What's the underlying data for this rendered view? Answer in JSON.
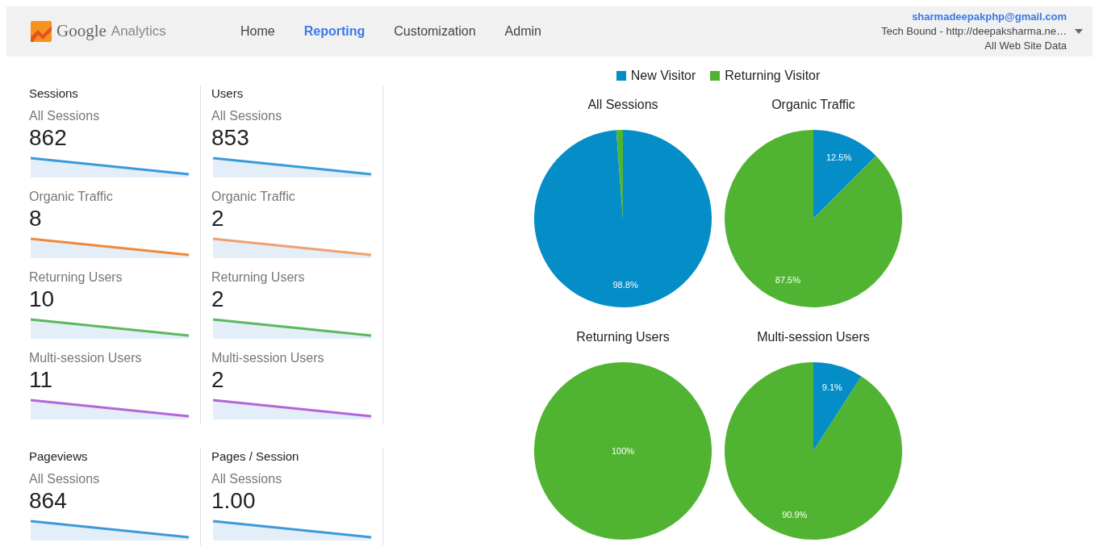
{
  "header": {
    "logo": "Google",
    "product": "Analytics",
    "nav": [
      {
        "label": "Home",
        "selected": false
      },
      {
        "label": "Reporting",
        "selected": true
      },
      {
        "label": "Customization",
        "selected": false
      },
      {
        "label": "Admin",
        "selected": false
      }
    ],
    "account": {
      "email": "sharmadeepakphp@gmail.com",
      "property": "Tech Bound - http://deepaksharma.ne…",
      "view": "All Web Site Data"
    }
  },
  "metric_groups": [
    {
      "panels": [
        {
          "title": "Sessions",
          "metrics": [
            {
              "label": "All Sessions",
              "value": "862",
              "color": "#3b9ad9"
            },
            {
              "label": "Organic Traffic",
              "value": "8",
              "color": "#f0883a"
            },
            {
              "label": "Returning Users",
              "value": "10",
              "color": "#5cb85c"
            },
            {
              "label": "Multi-session Users",
              "value": "11",
              "color": "#b565d9"
            }
          ]
        },
        {
          "title": "Users",
          "metrics": [
            {
              "label": "All Sessions",
              "value": "853",
              "color": "#3b9ad9"
            },
            {
              "label": "Organic Traffic",
              "value": "2",
              "color": "#f0a070"
            },
            {
              "label": "Returning Users",
              "value": "2",
              "color": "#5cb85c"
            },
            {
              "label": "Multi-session Users",
              "value": "2",
              "color": "#b565d9"
            }
          ]
        }
      ]
    },
    {
      "panels": [
        {
          "title": "Pageviews",
          "metrics": [
            {
              "label": "All Sessions",
              "value": "864",
              "color": "#3b9ad9"
            }
          ]
        },
        {
          "title": "Pages / Session",
          "metrics": [
            {
              "label": "All Sessions",
              "value": "1.00",
              "color": "#3b9ad9"
            }
          ]
        }
      ]
    }
  ],
  "legend": [
    {
      "label": "New Visitor",
      "color": "#058dc7"
    },
    {
      "label": "Returning Visitor",
      "color": "#50b432"
    }
  ],
  "pies": [
    {
      "chart_data": {
        "type": "pie",
        "title": "All Sessions",
        "series": [
          {
            "values": [
              98.8,
              1.2
            ]
          }
        ],
        "value_labels": [
          "98.8%",
          null
        ]
      }
    },
    {
      "chart_data": {
        "type": "pie",
        "title": "Organic Traffic",
        "series": [
          {
            "values": [
              12.5,
              87.5
            ]
          }
        ],
        "value_labels": [
          "12.5%",
          "87.5%"
        ]
      }
    },
    {
      "chart_data": {
        "type": "pie",
        "title": "Returning Users",
        "series": [
          {
            "values": [
              0,
              100
            ]
          }
        ],
        "value_labels": [
          null,
          "100%"
        ]
      }
    },
    {
      "chart_data": {
        "type": "pie",
        "title": "Multi-session Users",
        "series": [
          {
            "values": [
              9.1,
              90.9
            ]
          }
        ],
        "value_labels": [
          "9.1%",
          "90.9%"
        ]
      }
    }
  ]
}
